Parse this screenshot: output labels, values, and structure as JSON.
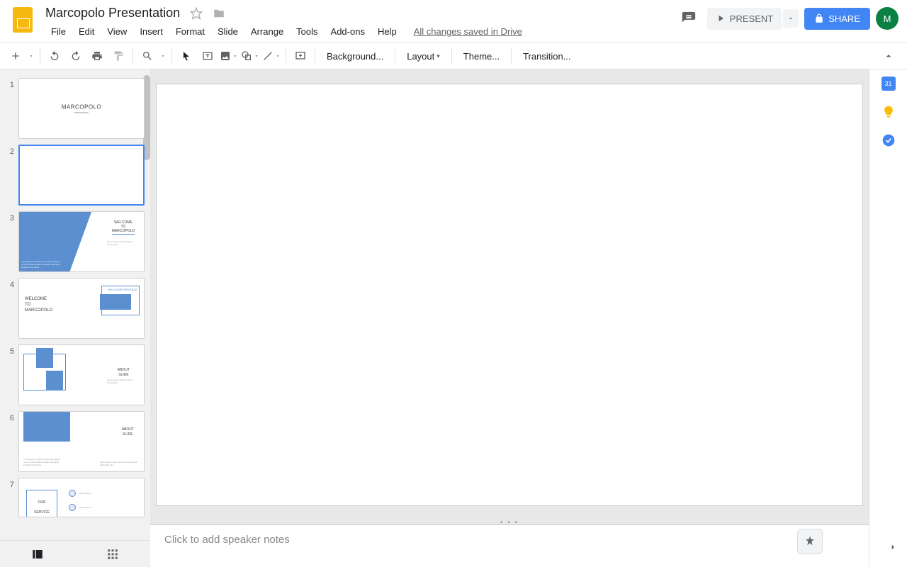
{
  "doc": {
    "title": "Marcopolo Presentation",
    "saved": "All changes saved in Drive"
  },
  "menu": {
    "file": "File",
    "edit": "Edit",
    "view": "View",
    "insert": "Insert",
    "format": "Format",
    "slide": "Slide",
    "arrange": "Arrange",
    "tools": "Tools",
    "addons": "Add-ons",
    "help": "Help"
  },
  "header": {
    "present": "PRESENT",
    "share": "SHARE",
    "avatar": "M"
  },
  "toolbar": {
    "background": "Background...",
    "layout": "Layout",
    "theme": "Theme...",
    "transition": "Transition..."
  },
  "notes": {
    "placeholder": "Click to add speaker notes"
  },
  "sidebar": {
    "cal": "31"
  },
  "slides": {
    "s1": {
      "num": "1",
      "title": "MARCOPOLO"
    },
    "s2": {
      "num": "2"
    },
    "s3": {
      "num": "3",
      "title1": "WELCOME",
      "title2": "TO",
      "title3": "MARCOPOLO"
    },
    "s4": {
      "num": "4",
      "title1": "WELCOME",
      "title2": "TO",
      "title3": "MARCOPOLO",
      "label": "WELCOME MESSAGE"
    },
    "s5": {
      "num": "5",
      "title1": "ABOUT",
      "title2": "SLIDE"
    },
    "s6": {
      "num": "6",
      "title1": "ABOUT",
      "title2": "SLIDE"
    },
    "s7": {
      "num": "7",
      "title1": "OUR",
      "title2": "SERVICE"
    }
  }
}
